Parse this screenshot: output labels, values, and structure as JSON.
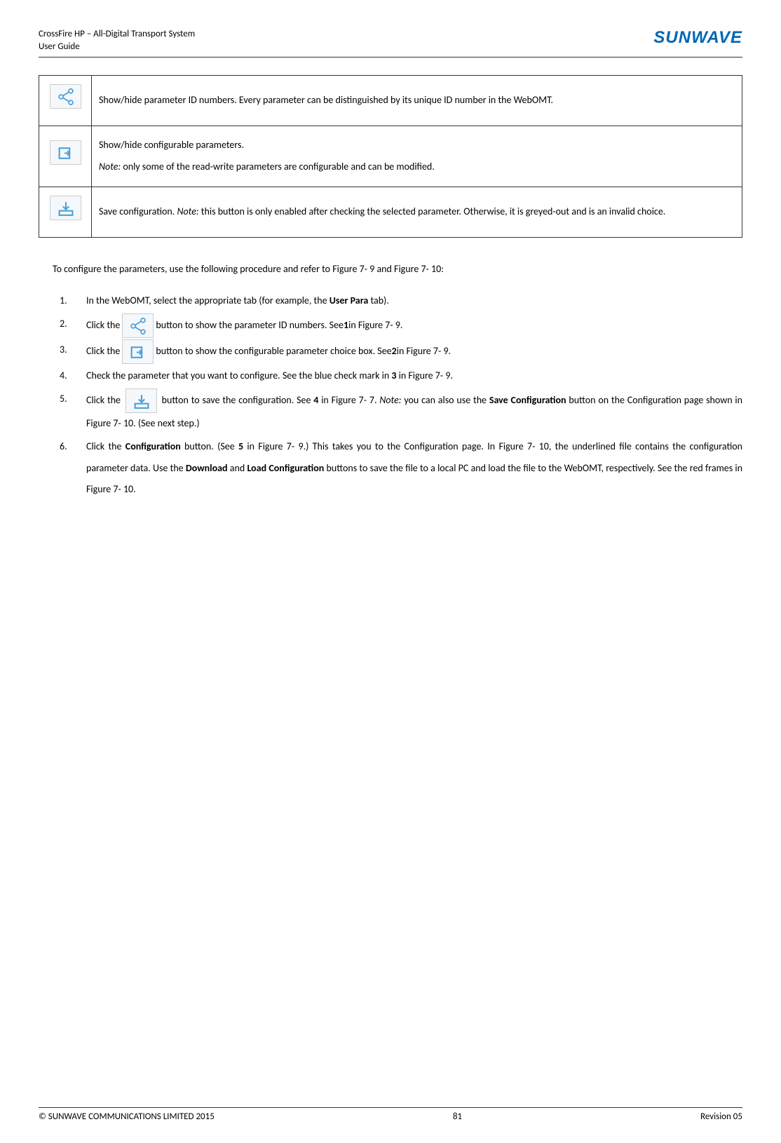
{
  "header": {
    "title_line1": "CrossFire HP – All-Digital Transport System",
    "title_line2": "User Guide",
    "logo": "SUNWAVE"
  },
  "table": {
    "rows": [
      {
        "icon": "share-icon",
        "text": "Show/hide parameter ID numbers. Every parameter can be distinguished by its unique ID number in the WebOMT."
      },
      {
        "icon": "config-icon",
        "line1": "Show/hide configurable parameters.",
        "note_label": "Note:",
        "note_text": " only some of the read-write parameters are configurable and can be modified."
      },
      {
        "icon": "save-icon",
        "pre_text": "Save configuration. ",
        "note_label": "Note:",
        "note_text": " this button is only enabled after checking the selected parameter. Otherwise, it is greyed-out and is an invalid choice."
      }
    ]
  },
  "intro": "To configure the parameters, use the following procedure and refer to Figure 7- 9 and Figure 7- 10:",
  "steps": {
    "s1": {
      "num": "1.",
      "pre": "In the WebOMT, select the appropriate tab (for example, the ",
      "bold": "User Para",
      "post": " tab)."
    },
    "s2": {
      "num": "2.",
      "pre": "Click the ",
      "post_pre": " button to show the parameter ID numbers. See ",
      "bold": "1",
      "post": " in Figure 7- 9."
    },
    "s3": {
      "num": "3.",
      "pre": "Click the ",
      "post_pre": " button to show the configurable parameter choice box. See ",
      "bold": "2",
      "post": " in Figure 7- 9."
    },
    "s4": {
      "num": "4.",
      "pre": "Check the parameter that you want to configure. See the blue check mark in ",
      "bold": "3",
      "post": " in Figure 7- 9."
    },
    "s5": {
      "num": "5.",
      "pre": "Click the ",
      "post_pre": " button to save the configuration. See ",
      "bold1": "4",
      "mid1": " in Figure 7- 7. ",
      "note": "Note:",
      "mid2": " you can also use the ",
      "bold2": "Save Configuration",
      "post": " button on the Configuration page shown in Figure 7- 10. (See next step.)"
    },
    "s6": {
      "num": "6.",
      "pre": "Click the ",
      "bold1": "Configuration",
      "mid1": " button. (See ",
      "bold2": "5",
      "mid2": " in Figure 7- 9.) This takes you to the Configuration page. In Figure 7- 10, the underlined file contains the configuration parameter data. Use the ",
      "bold3": "Download",
      "mid3": " and ",
      "bold4": "Load Configuration",
      "post": " buttons to save the file to a local PC and load the file to the WebOMT, respectively. See the red frames in Figure 7- 10."
    }
  },
  "footer": {
    "left": "© SUNWAVE COMMUNICATIONS LIMITED 2015",
    "center": "81",
    "right": "Revision 05"
  }
}
